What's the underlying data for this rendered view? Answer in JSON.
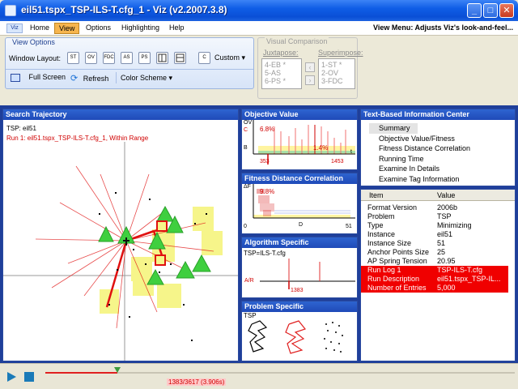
{
  "window": {
    "title": "eil51.tspx_TSP-ILS-T.cfg_1 - Viz (v2.2007.3.8)",
    "minimize": "_",
    "maximize": "□",
    "close": "✕"
  },
  "menu": {
    "items": [
      "Home",
      "View",
      "Options",
      "Highlighting",
      "Help"
    ],
    "active": "View",
    "hint": "View Menu: Adjusts Viz's look-and-feel..."
  },
  "view_options": {
    "title": "View Options",
    "window_layout_label": "Window Layout:",
    "layout_buttons": [
      "ST",
      "OV",
      "FDC",
      "AS",
      "PS",
      "",
      "",
      "C"
    ],
    "custom_label": "Custom",
    "full_screen_label": "Full Screen",
    "refresh_label": "Refresh",
    "color_scheme_label": "Color Scheme"
  },
  "visual_comparison": {
    "title": "Visual Comparison",
    "juxtapose_label": "Juxtapose:",
    "juxtapose_items": [
      "4-EB *",
      "5-AS",
      "6-PS *"
    ],
    "superimpose_label": "Superimpose:",
    "superimpose_items": [
      "1-ST *",
      "2-OV",
      "3-FDC"
    ]
  },
  "search_trajectory": {
    "title": "Search Trajectory",
    "tsp_label": "TSP: eil51",
    "run_label": "Run 1: eil51.tspx_TSP-ILS-T.cfg_1, Within Range"
  },
  "objective_value": {
    "title": "Objective Value",
    "axis_y": "OV",
    "label_c": "C",
    "label_b": "B",
    "value_top": "6.8%",
    "value_bottom": "1.4%",
    "axis_x": "t",
    "tick_left": "353",
    "tick_right": "1453"
  },
  "fdc": {
    "title": "Fitness Distance Correlation",
    "axis_y": "ΔF",
    "label_pct": "9.8%",
    "label_zero": "0",
    "axis_x": "D",
    "tick_right": "51"
  },
  "algorithm_specific": {
    "title": "Algorithm Specific",
    "config": "TSP=ILS-T.cfg",
    "axis": "A/R",
    "tick": "1383"
  },
  "problem_specific": {
    "title": "Problem Specific",
    "label": "TSP"
  },
  "text_info": {
    "title": "Text-Based Information Center",
    "items": [
      "Summary",
      "Objective Value/Fitness",
      "Fitness Distance Correlation",
      "Running Time",
      "Examine In Details",
      "Examine Tag Information"
    ]
  },
  "properties": {
    "col_item": "Item",
    "col_value": "Value",
    "rows": [
      {
        "item": "Format Version",
        "value": "2006b",
        "hl": false
      },
      {
        "item": "Problem",
        "value": "TSP",
        "hl": false
      },
      {
        "item": "Type",
        "value": "Minimizing",
        "hl": false
      },
      {
        "item": "Instance",
        "value": "eil51",
        "hl": false
      },
      {
        "item": "Instance Size",
        "value": "51",
        "hl": false
      },
      {
        "item": "Anchor Points Size",
        "value": "25",
        "hl": false
      },
      {
        "item": "AP Spring Tension",
        "value": "20.95",
        "hl": false
      },
      {
        "item": "Run Log 1",
        "value": "TSP-ILS-T.cfg",
        "hl": true
      },
      {
        "item": "Run Description",
        "value": "eil51.tspx_TSP-IL...",
        "hl": true
      },
      {
        "item": "Number of Entries",
        "value": "5,000",
        "hl": true
      }
    ]
  },
  "status": {
    "progress": "1383/3617 (3.906s)",
    "progress_fraction": 0.382
  },
  "colors": {
    "title_bar": "#0f5de6",
    "panel_header": "#2e64d0",
    "highlight_row": "#f00000",
    "trajectory_red": "#e01010",
    "triangle_green": "#3fcf3f",
    "square_yellow": "#f6f58a"
  }
}
